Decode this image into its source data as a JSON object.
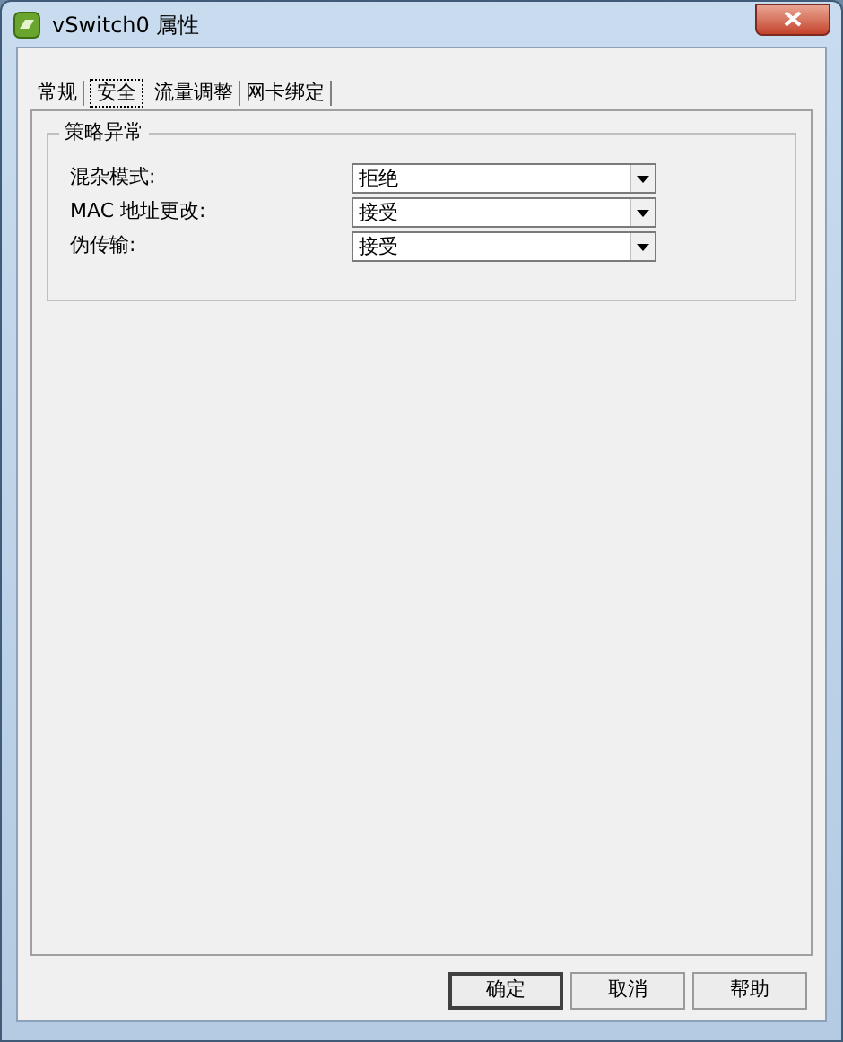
{
  "window": {
    "title": "vSwitch0 属性"
  },
  "tabs": [
    {
      "label": "常规",
      "selected": false
    },
    {
      "label": "安全",
      "selected": true
    },
    {
      "label": "流量调整",
      "selected": false
    },
    {
      "label": "网卡绑定",
      "selected": false
    }
  ],
  "group": {
    "title": "策略异常",
    "fields": [
      {
        "label": "混杂模式:",
        "value": "拒绝"
      },
      {
        "label": "MAC 地址更改:",
        "value": "接受"
      },
      {
        "label": "伪传输:",
        "value": "接受"
      }
    ]
  },
  "buttons": [
    {
      "label": "确定",
      "default": true
    },
    {
      "label": "取消",
      "default": false
    },
    {
      "label": "帮助",
      "default": false
    }
  ]
}
